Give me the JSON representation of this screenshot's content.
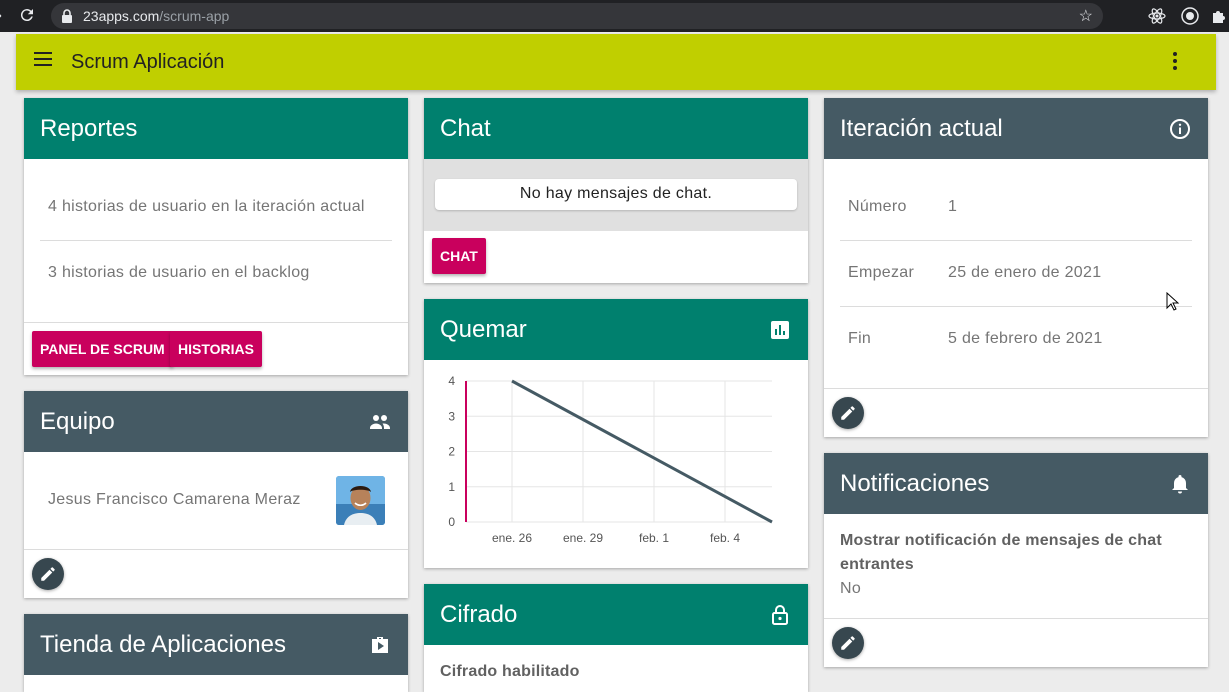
{
  "browser": {
    "url_host": "23apps.com",
    "url_path": "/scrum-app"
  },
  "appbar": {
    "title": "Scrum Aplicación"
  },
  "reportes": {
    "title": "Reportes",
    "items": [
      "4 historias de usuario en la iteración actual",
      "3 historias de usuario en el backlog"
    ],
    "buttons": [
      "PANEL DE SCRUM",
      "HISTORIAS"
    ]
  },
  "equipo": {
    "title": "Equipo",
    "icon": "group-icon",
    "member_name": "Jesus Francisco Camarena Meraz"
  },
  "tienda": {
    "title": "Tienda de Aplicaciones",
    "icon": "shop-icon"
  },
  "chat": {
    "title": "Chat",
    "empty_message": "No hay mensajes de chat.",
    "button": "CHAT"
  },
  "quemar": {
    "title": "Quemar",
    "icon": "bar-chart-icon"
  },
  "chart_data": {
    "type": "line",
    "x": [
      "ene. 26",
      "feb. 5"
    ],
    "values": [
      4,
      0
    ],
    "x_tick_labels": [
      "ene. 26",
      "ene. 29",
      "feb. 1",
      "feb. 4"
    ],
    "y_tick_labels": [
      "0",
      "1",
      "2",
      "3",
      "4"
    ],
    "ylim": [
      0,
      4
    ],
    "grid": true,
    "title": "",
    "xlabel": "",
    "ylabel": "",
    "line_color": "#455a64",
    "today_marker_color": "#c9005d"
  },
  "cifrado": {
    "title": "Cifrado",
    "icon": "lock-open-icon",
    "setting_label": "Cifrado habilitado"
  },
  "iteracion": {
    "title": "Iteración actual",
    "icon": "info-icon",
    "rows": [
      {
        "label": "Número",
        "value": "1"
      },
      {
        "label": "Empezar",
        "value": "25 de enero de 2021"
      },
      {
        "label": "Fin",
        "value": "5 de febrero de 2021"
      }
    ]
  },
  "notificaciones": {
    "title": "Notificaciones",
    "icon": "bell-icon",
    "setting_label": "Mostrar notificación de mensajes de chat entrantes",
    "setting_value": "No"
  },
  "colors": {
    "appbar": "#c0cf00",
    "teal": "#00806e",
    "slate": "#455a64",
    "accent": "#c9005d"
  }
}
